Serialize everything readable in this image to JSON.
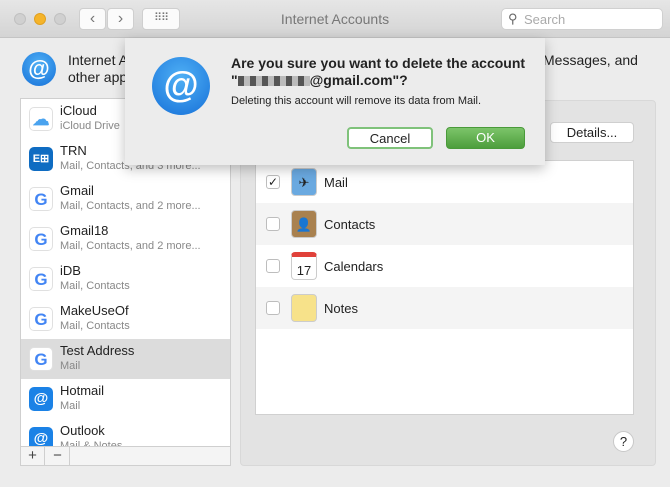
{
  "window": {
    "title": "Internet Accounts",
    "search_placeholder": "Search"
  },
  "intro": {
    "left_line1": "Internet A",
    "left_line2": "other app",
    "right_line1": "Messages, and"
  },
  "accounts": [
    {
      "name": "iCloud",
      "sub": "iCloud Drive",
      "icon": "icloud-icon"
    },
    {
      "name": "TRN",
      "sub": "Mail, Contacts, and 3 more...",
      "icon": "exchange-icon"
    },
    {
      "name": "Gmail",
      "sub": "Mail, Contacts, and 2 more...",
      "icon": "google-icon"
    },
    {
      "name": "Gmail18",
      "sub": "Mail, Contacts, and 2 more...",
      "icon": "google-icon"
    },
    {
      "name": "iDB",
      "sub": "Mail, Contacts",
      "icon": "google-icon"
    },
    {
      "name": "MakeUseOf",
      "sub": "Mail, Contacts",
      "icon": "google-icon"
    },
    {
      "name": "Test Address",
      "sub": "Mail",
      "icon": "google-icon",
      "selected": true
    },
    {
      "name": "Hotmail",
      "sub": "Mail",
      "icon": "at-icon"
    },
    {
      "name": "Outlook",
      "sub": "Mail & Notes",
      "icon": "at-icon"
    }
  ],
  "list_buttons": {
    "add": "+",
    "remove": "−"
  },
  "details_label": "Details...",
  "services": [
    {
      "label": "Mail",
      "checked": true
    },
    {
      "label": "Contacts",
      "checked": false
    },
    {
      "label": "Calendars",
      "checked": false
    },
    {
      "label": "Notes",
      "checked": false
    }
  ],
  "calendar_day": "17",
  "help_label": "?",
  "dialog": {
    "title_line1": "Are you sure you want to delete the account",
    "title_line2_suffix": "@gmail.com\"?",
    "title_line2_prefix": "\"",
    "message": "Deleting this account will remove its data from Mail.",
    "cancel": "Cancel",
    "ok": "OK"
  },
  "colors": {
    "accent_green": "#5aad48",
    "at_blue": "#1b82e6"
  }
}
